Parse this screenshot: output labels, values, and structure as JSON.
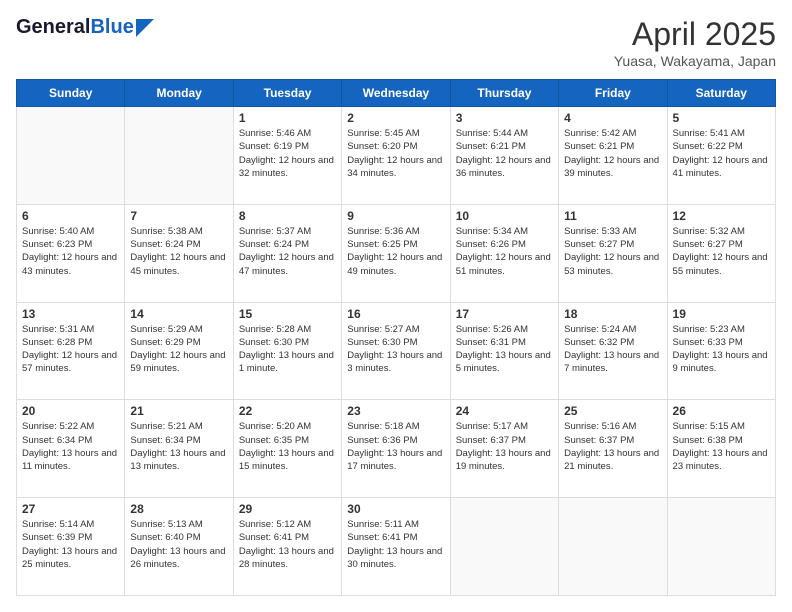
{
  "logo": {
    "part1": "General",
    "part2": "Blue"
  },
  "title": "April 2025",
  "location": "Yuasa, Wakayama, Japan",
  "weekdays": [
    "Sunday",
    "Monday",
    "Tuesday",
    "Wednesday",
    "Thursday",
    "Friday",
    "Saturday"
  ],
  "weeks": [
    [
      {
        "day": "",
        "sunrise": "",
        "sunset": "",
        "daylight": "",
        "empty": true
      },
      {
        "day": "",
        "sunrise": "",
        "sunset": "",
        "daylight": "",
        "empty": true
      },
      {
        "day": "1",
        "sunrise": "Sunrise: 5:46 AM",
        "sunset": "Sunset: 6:19 PM",
        "daylight": "Daylight: 12 hours and 32 minutes."
      },
      {
        "day": "2",
        "sunrise": "Sunrise: 5:45 AM",
        "sunset": "Sunset: 6:20 PM",
        "daylight": "Daylight: 12 hours and 34 minutes."
      },
      {
        "day": "3",
        "sunrise": "Sunrise: 5:44 AM",
        "sunset": "Sunset: 6:21 PM",
        "daylight": "Daylight: 12 hours and 36 minutes."
      },
      {
        "day": "4",
        "sunrise": "Sunrise: 5:42 AM",
        "sunset": "Sunset: 6:21 PM",
        "daylight": "Daylight: 12 hours and 39 minutes."
      },
      {
        "day": "5",
        "sunrise": "Sunrise: 5:41 AM",
        "sunset": "Sunset: 6:22 PM",
        "daylight": "Daylight: 12 hours and 41 minutes."
      }
    ],
    [
      {
        "day": "6",
        "sunrise": "Sunrise: 5:40 AM",
        "sunset": "Sunset: 6:23 PM",
        "daylight": "Daylight: 12 hours and 43 minutes."
      },
      {
        "day": "7",
        "sunrise": "Sunrise: 5:38 AM",
        "sunset": "Sunset: 6:24 PM",
        "daylight": "Daylight: 12 hours and 45 minutes."
      },
      {
        "day": "8",
        "sunrise": "Sunrise: 5:37 AM",
        "sunset": "Sunset: 6:24 PM",
        "daylight": "Daylight: 12 hours and 47 minutes."
      },
      {
        "day": "9",
        "sunrise": "Sunrise: 5:36 AM",
        "sunset": "Sunset: 6:25 PM",
        "daylight": "Daylight: 12 hours and 49 minutes."
      },
      {
        "day": "10",
        "sunrise": "Sunrise: 5:34 AM",
        "sunset": "Sunset: 6:26 PM",
        "daylight": "Daylight: 12 hours and 51 minutes."
      },
      {
        "day": "11",
        "sunrise": "Sunrise: 5:33 AM",
        "sunset": "Sunset: 6:27 PM",
        "daylight": "Daylight: 12 hours and 53 minutes."
      },
      {
        "day": "12",
        "sunrise": "Sunrise: 5:32 AM",
        "sunset": "Sunset: 6:27 PM",
        "daylight": "Daylight: 12 hours and 55 minutes."
      }
    ],
    [
      {
        "day": "13",
        "sunrise": "Sunrise: 5:31 AM",
        "sunset": "Sunset: 6:28 PM",
        "daylight": "Daylight: 12 hours and 57 minutes."
      },
      {
        "day": "14",
        "sunrise": "Sunrise: 5:29 AM",
        "sunset": "Sunset: 6:29 PM",
        "daylight": "Daylight: 12 hours and 59 minutes."
      },
      {
        "day": "15",
        "sunrise": "Sunrise: 5:28 AM",
        "sunset": "Sunset: 6:30 PM",
        "daylight": "Daylight: 13 hours and 1 minute."
      },
      {
        "day": "16",
        "sunrise": "Sunrise: 5:27 AM",
        "sunset": "Sunset: 6:30 PM",
        "daylight": "Daylight: 13 hours and 3 minutes."
      },
      {
        "day": "17",
        "sunrise": "Sunrise: 5:26 AM",
        "sunset": "Sunset: 6:31 PM",
        "daylight": "Daylight: 13 hours and 5 minutes."
      },
      {
        "day": "18",
        "sunrise": "Sunrise: 5:24 AM",
        "sunset": "Sunset: 6:32 PM",
        "daylight": "Daylight: 13 hours and 7 minutes."
      },
      {
        "day": "19",
        "sunrise": "Sunrise: 5:23 AM",
        "sunset": "Sunset: 6:33 PM",
        "daylight": "Daylight: 13 hours and 9 minutes."
      }
    ],
    [
      {
        "day": "20",
        "sunrise": "Sunrise: 5:22 AM",
        "sunset": "Sunset: 6:34 PM",
        "daylight": "Daylight: 13 hours and 11 minutes."
      },
      {
        "day": "21",
        "sunrise": "Sunrise: 5:21 AM",
        "sunset": "Sunset: 6:34 PM",
        "daylight": "Daylight: 13 hours and 13 minutes."
      },
      {
        "day": "22",
        "sunrise": "Sunrise: 5:20 AM",
        "sunset": "Sunset: 6:35 PM",
        "daylight": "Daylight: 13 hours and 15 minutes."
      },
      {
        "day": "23",
        "sunrise": "Sunrise: 5:18 AM",
        "sunset": "Sunset: 6:36 PM",
        "daylight": "Daylight: 13 hours and 17 minutes."
      },
      {
        "day": "24",
        "sunrise": "Sunrise: 5:17 AM",
        "sunset": "Sunset: 6:37 PM",
        "daylight": "Daylight: 13 hours and 19 minutes."
      },
      {
        "day": "25",
        "sunrise": "Sunrise: 5:16 AM",
        "sunset": "Sunset: 6:37 PM",
        "daylight": "Daylight: 13 hours and 21 minutes."
      },
      {
        "day": "26",
        "sunrise": "Sunrise: 5:15 AM",
        "sunset": "Sunset: 6:38 PM",
        "daylight": "Daylight: 13 hours and 23 minutes."
      }
    ],
    [
      {
        "day": "27",
        "sunrise": "Sunrise: 5:14 AM",
        "sunset": "Sunset: 6:39 PM",
        "daylight": "Daylight: 13 hours and 25 minutes."
      },
      {
        "day": "28",
        "sunrise": "Sunrise: 5:13 AM",
        "sunset": "Sunset: 6:40 PM",
        "daylight": "Daylight: 13 hours and 26 minutes."
      },
      {
        "day": "29",
        "sunrise": "Sunrise: 5:12 AM",
        "sunset": "Sunset: 6:41 PM",
        "daylight": "Daylight: 13 hours and 28 minutes."
      },
      {
        "day": "30",
        "sunrise": "Sunrise: 5:11 AM",
        "sunset": "Sunset: 6:41 PM",
        "daylight": "Daylight: 13 hours and 30 minutes."
      },
      {
        "day": "",
        "sunrise": "",
        "sunset": "",
        "daylight": "",
        "empty": true
      },
      {
        "day": "",
        "sunrise": "",
        "sunset": "",
        "daylight": "",
        "empty": true
      },
      {
        "day": "",
        "sunrise": "",
        "sunset": "",
        "daylight": "",
        "empty": true
      }
    ]
  ]
}
